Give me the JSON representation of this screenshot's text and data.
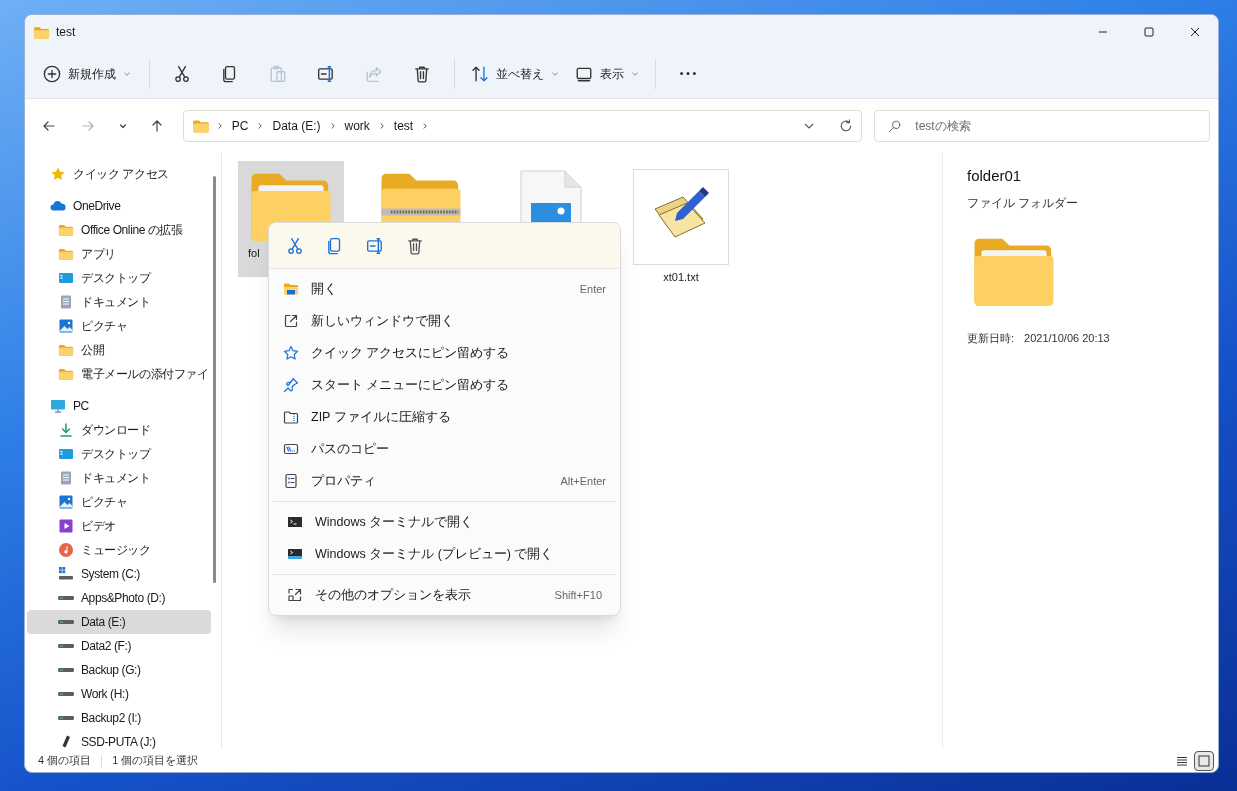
{
  "window": {
    "title": "test"
  },
  "toolbar": {
    "groups": [
      [
        {
          "kind": "new",
          "label": "新規作成",
          "disabled": false
        }
      ],
      [
        {
          "kind": "cut",
          "disabled": false
        },
        {
          "kind": "copy",
          "disabled": false
        },
        {
          "kind": "paste",
          "disabled": true
        },
        {
          "kind": "rename",
          "disabled": false
        },
        {
          "kind": "share",
          "disabled": true
        },
        {
          "kind": "delete",
          "disabled": false
        }
      ],
      [
        {
          "kind": "sort",
          "label": "並べ替え",
          "disabled": false
        },
        {
          "kind": "view",
          "label": "表示",
          "disabled": false
        }
      ],
      [
        {
          "kind": "more",
          "disabled": false
        }
      ]
    ]
  },
  "nav": [
    {
      "kind": "back",
      "disabled": false
    },
    {
      "kind": "forward",
      "disabled": true
    },
    {
      "kind": "recent",
      "disabled": false
    },
    {
      "kind": "up",
      "disabled": false
    }
  ],
  "address": {
    "segments": [
      "PC",
      "Data (E:)",
      "work",
      "test"
    ]
  },
  "search": {
    "placeholder": "testの検索"
  },
  "sidebar": {
    "items": [
      {
        "label": "クイック アクセス",
        "kind": "star",
        "selected": false
      },
      {
        "label": "OneDrive",
        "kind": "cloud",
        "selected": false,
        "children": [
          {
            "label": "Office Online の拡張",
            "kind": "folder",
            "selected": false
          },
          {
            "label": "アプリ",
            "kind": "folder",
            "selected": false
          },
          {
            "label": "デスクトップ",
            "kind": "desktop",
            "selected": false
          },
          {
            "label": "ドキュメント",
            "kind": "documents",
            "selected": false
          },
          {
            "label": "ピクチャ",
            "kind": "pictures",
            "selected": false
          },
          {
            "label": "公開",
            "kind": "folder",
            "selected": false
          },
          {
            "label": "電子メールの添付ファイ",
            "kind": "folder",
            "selected": false
          }
        ]
      },
      {
        "label": "PC",
        "kind": "pc",
        "selected": false,
        "children": [
          {
            "label": "ダウンロード",
            "kind": "download",
            "selected": false
          },
          {
            "label": "デスクトップ",
            "kind": "desktop",
            "selected": false
          },
          {
            "label": "ドキュメント",
            "kind": "documents",
            "selected": false
          },
          {
            "label": "ピクチャ",
            "kind": "pictures",
            "selected": false
          },
          {
            "label": "ビデオ",
            "kind": "videos",
            "selected": false
          },
          {
            "label": "ミュージック",
            "kind": "music",
            "selected": false
          },
          {
            "label": "System (C:)",
            "kind": "system-drive",
            "selected": false
          },
          {
            "label": "Apps&Photo (D:)",
            "kind": "drive",
            "selected": false
          },
          {
            "label": "Data (E:)",
            "kind": "drive",
            "selected": true
          },
          {
            "label": "Data2 (F:)",
            "kind": "drive",
            "selected": false
          },
          {
            "label": "Backup (G:)",
            "kind": "drive",
            "selected": false
          },
          {
            "label": "Work (H:)",
            "kind": "drive",
            "selected": false
          },
          {
            "label": "Backup2 (I:)",
            "kind": "drive",
            "selected": false
          },
          {
            "label": "SSD-PUTA (J:)",
            "kind": "usb",
            "selected": false
          }
        ]
      }
    ]
  },
  "files": [
    {
      "name": "fol",
      "kind": "folder",
      "selected": true
    },
    {
      "kind": "zip-folder",
      "selected": false
    },
    {
      "kind": "image-file",
      "selected": false
    },
    {
      "name": "xt01.txt",
      "kind": "text-file",
      "selected": false
    }
  ],
  "context_menu": {
    "groups": [
      [
        {
          "kind": "open",
          "label": "開く",
          "shortcut": "Enter"
        },
        {
          "kind": "new-window",
          "label": "新しいウィンドウで開く"
        },
        {
          "kind": "pin-quick",
          "label": "クイック アクセスにピン留めする"
        },
        {
          "kind": "pin-start",
          "label": "スタート メニューにピン留めする"
        },
        {
          "kind": "zip",
          "label": "ZIP ファイルに圧縮する"
        },
        {
          "kind": "copy-path",
          "label": "パスのコピー"
        },
        {
          "kind": "properties",
          "label": "プロパティ",
          "shortcut": "Alt+Enter"
        }
      ],
      [
        {
          "kind": "terminal",
          "label": "Windows ターミナルで開く"
        },
        {
          "kind": "terminal-preview",
          "label": "Windows ターミナル (プレビュー) で開く"
        }
      ],
      [
        {
          "kind": "more-options",
          "label": "その他のオプションを表示",
          "shortcut": "Shift+F10"
        }
      ]
    ]
  },
  "details": {
    "name": "folder01",
    "type": "ファイル フォルダー",
    "modified_label": "更新日時:",
    "modified": "2021/10/06 20:13"
  },
  "status_bar": {
    "item_count": "4 個の項目",
    "selection": "1 個の項目を選択",
    "views": [
      {
        "kind": "details",
        "selected": false
      },
      {
        "kind": "tiles",
        "selected": true
      }
    ]
  }
}
